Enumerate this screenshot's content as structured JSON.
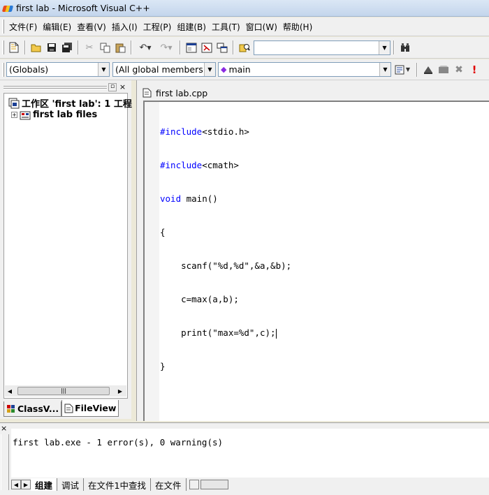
{
  "window": {
    "title": "first lab - Microsoft Visual C++"
  },
  "menu": [
    "文件(F)",
    "编辑(E)",
    "查看(V)",
    "插入(I)",
    "工程(P)",
    "组建(B)",
    "工具(T)",
    "窗口(W)",
    "帮助(H)"
  ],
  "toolbar_wizard": {
    "class_combo": "(Globals)",
    "members_combo": "(All global members",
    "function_combo": "main"
  },
  "workspace": {
    "root_label": "工作区 'first lab': 1 工程",
    "child_label": "first lab files",
    "tabs": [
      "ClassV...",
      "FileView"
    ]
  },
  "editor": {
    "tab_label": "first lab.cpp",
    "lines": [
      {
        "kw": "#include",
        "rest": "<stdio.h>"
      },
      {
        "kw": "#include",
        "rest": "<cmath>"
      },
      {
        "kw": "void",
        "rest": " main()"
      },
      {
        "kw": "",
        "rest": "{"
      },
      {
        "kw": "",
        "rest": "    scanf(\"%d,%d\",&a,&b);"
      },
      {
        "kw": "",
        "rest": "    c=max(a,b);"
      },
      {
        "kw": "",
        "rest": "    print(\"max=%d\",c);"
      },
      {
        "kw": "",
        "rest": "}"
      }
    ]
  },
  "output": {
    "message": "first lab.exe - 1 error(s), 0 warning(s)",
    "tabs": [
      "组建",
      "调试",
      "在文件1中查找",
      "在文件"
    ]
  },
  "colors": {
    "keyword": "#0000ff",
    "title_bar": "#c3d5ec"
  }
}
